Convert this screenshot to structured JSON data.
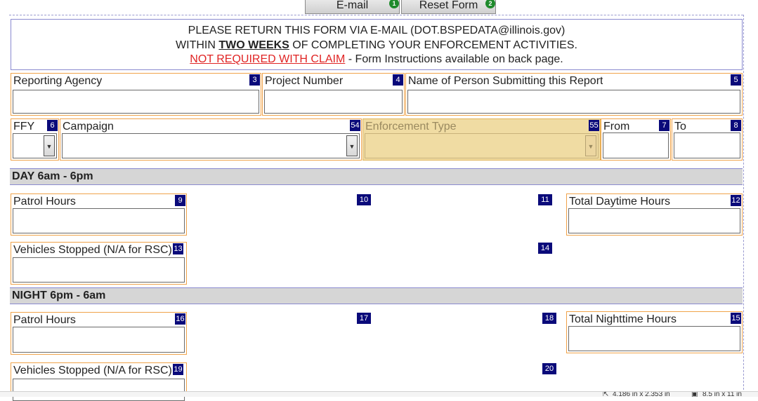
{
  "toolbar": {
    "email_label": "E-mail",
    "email_badge": "1",
    "reset_label": "Reset Form",
    "reset_badge": "2"
  },
  "notice": {
    "line1": "PLEASE RETURN THIS FORM VIA E-MAIL (DOT.BSPEDATA@illinois.gov)",
    "line2_pre": "WITHIN ",
    "line2_bold": "TWO WEEKS",
    "line2_post": " OF COMPLETING YOUR ENFORCEMENT ACTIVITIES.",
    "line3_red": "NOT REQUIRED WITH CLAIM",
    "line3_post": " - Form Instructions available on back page."
  },
  "fields": {
    "reporting_agency": {
      "label": "Reporting Agency",
      "num": "3",
      "value": ""
    },
    "project_number": {
      "label": "Project Number",
      "num": "4",
      "value": ""
    },
    "submitter_name": {
      "label": "Name of Person Submitting this Report",
      "num": "5",
      "value": ""
    },
    "ffy": {
      "label": "FFY",
      "num": "6",
      "value": ""
    },
    "campaign": {
      "label": "Campaign",
      "num": "54",
      "value": ""
    },
    "enforcement_type": {
      "label": "Enforcement Type",
      "num": "55",
      "value": ""
    },
    "from": {
      "label": "From",
      "num": "7",
      "value": ""
    },
    "to": {
      "label": "To",
      "num": "8",
      "value": ""
    }
  },
  "day": {
    "title": "DAY 6am - 6pm",
    "patrol_hours": {
      "label": "Patrol Hours",
      "num": "9"
    },
    "col2_num": "10",
    "col3_num": "11",
    "total_hours": {
      "label": "Total Daytime Hours",
      "num": "12"
    },
    "vehicles_stopped": {
      "label": "Vehicles Stopped (N/A for RSC)",
      "num": "13"
    },
    "vehicles_col3_num": "14"
  },
  "night": {
    "title": "NIGHT 6pm - 6am",
    "patrol_hours": {
      "label": "Patrol Hours",
      "num": "16"
    },
    "col2_num": "17",
    "col3_num": "18",
    "total_hours": {
      "label": "Total Nighttime Hours",
      "num": "15"
    },
    "vehicles_stopped": {
      "label": "Vehicles Stopped (N/A for RSC)",
      "num": "19"
    },
    "vehicles_col3_num": "20"
  },
  "statusbar": {
    "dimensions": "4.186 in x 2.353 in",
    "size": "8.5 in x 11 in"
  },
  "colors": {
    "field_border": "#f0a34a",
    "number_badge": "#0a0a7a",
    "disabled_fill": "#f0dca3",
    "section_fill": "#d6d6d6",
    "notice_red": "#e02424",
    "button_badge": "#1f8a2c"
  }
}
